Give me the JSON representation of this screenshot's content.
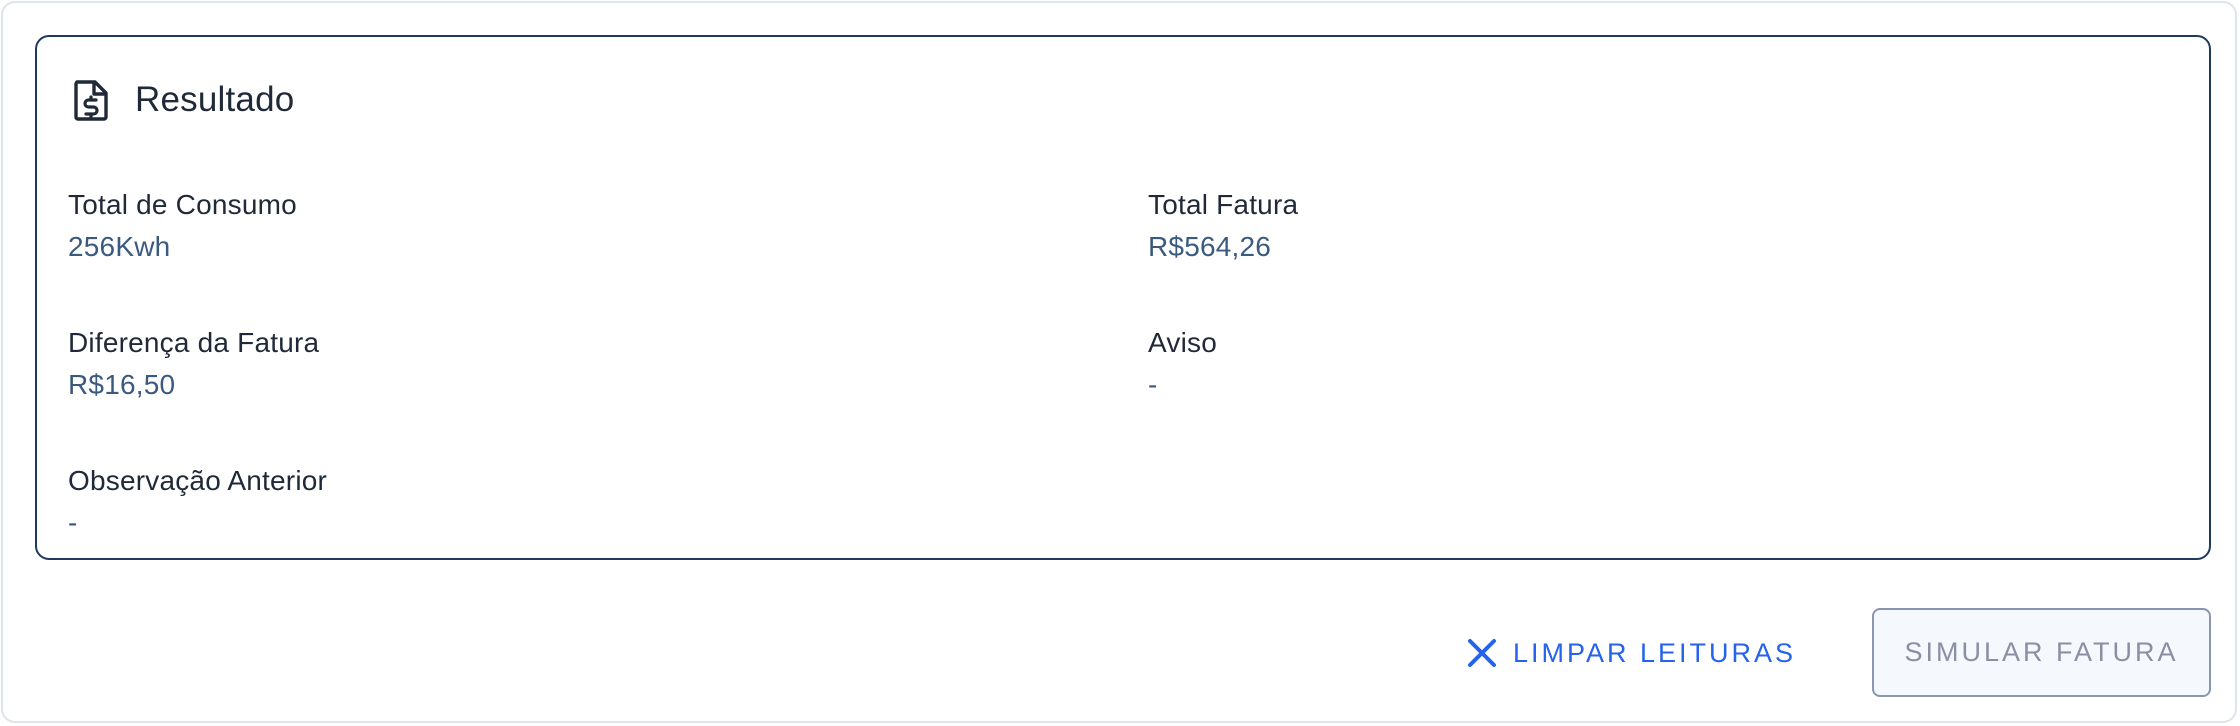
{
  "card": {
    "title": "Resultado",
    "icon": "invoice-dollar-icon"
  },
  "fields": [
    {
      "label": "Total de Consumo",
      "value": "256Kwh"
    },
    {
      "label": "Total Fatura",
      "value": "R$564,26"
    },
    {
      "label": "Diferença da Fatura",
      "value": "R$16,50"
    },
    {
      "label": "Aviso",
      "value": "-"
    },
    {
      "label": "Observação Anterior",
      "value": "-"
    }
  ],
  "actions": {
    "clear_label": "LIMPAR LEITURAS",
    "clear_icon": "close-icon",
    "simulate_label": "SIMULAR FATURA",
    "simulate_disabled": true
  },
  "colors": {
    "card_border": "#1e3a5f",
    "value_text": "#3b5a80",
    "accent": "#2563eb",
    "disabled_text": "#8a8fa3"
  }
}
